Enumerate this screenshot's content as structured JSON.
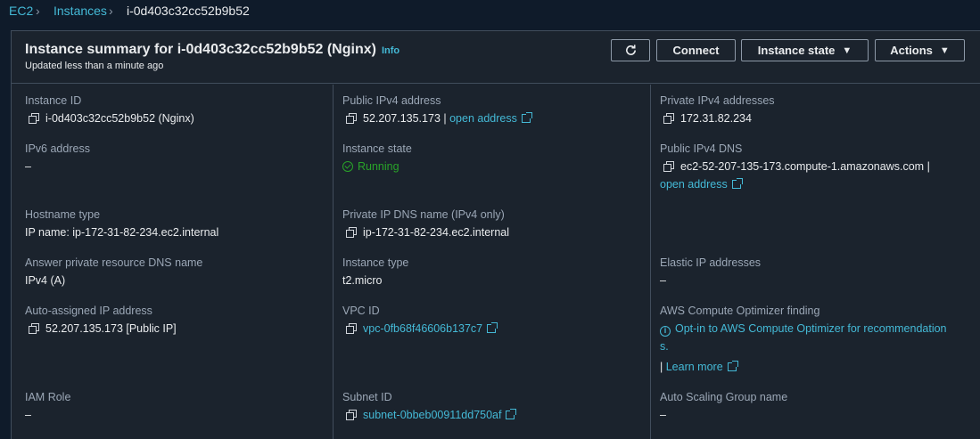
{
  "breadcrumb": {
    "ec2": "EC2",
    "instances": "Instances",
    "current": "i-0d403c32cc52b9b52"
  },
  "header": {
    "title": "Instance summary for i-0d403c32cc52b9b52 (Nginx)",
    "info": "Info",
    "updated": "Updated less than a minute ago",
    "connect": "Connect",
    "instance_state": "Instance state",
    "actions": "Actions"
  },
  "col1": {
    "instance_id_label": "Instance ID",
    "instance_id": "i-0d403c32cc52b9b52 (Nginx)",
    "ipv6_label": "IPv6 address",
    "ipv6": "–",
    "hostname_type_label": "Hostname type",
    "hostname_type": "IP name: ip-172-31-82-234.ec2.internal",
    "answer_dns_label": "Answer private resource DNS name",
    "answer_dns": "IPv4 (A)",
    "auto_ip_label": "Auto-assigned IP address",
    "auto_ip": "52.207.135.173 [Public IP]",
    "iam_label": "IAM Role",
    "iam": "–"
  },
  "col2": {
    "public_ipv4_label": "Public IPv4 address",
    "public_ipv4": "52.207.135.173",
    "sep": "|",
    "open_address": "open address",
    "state_label": "Instance state",
    "state": "Running",
    "private_dns_label": "Private IP DNS name (IPv4 only)",
    "private_dns": "ip-172-31-82-234.ec2.internal",
    "type_label": "Instance type",
    "type": "t2.micro",
    "vpc_label": "VPC ID",
    "vpc": "vpc-0fb68f46606b137c7",
    "subnet_label": "Subnet ID",
    "subnet": "subnet-0bbeb00911dd750af"
  },
  "col3": {
    "private_ipv4_label": "Private IPv4 addresses",
    "private_ipv4": "172.31.82.234",
    "public_dns_label": "Public IPv4 DNS",
    "public_dns": "ec2-52-207-135-173.compute-1.amazonaws.com",
    "sep": "|",
    "open_address": "open address",
    "elastic_label": "Elastic IP addresses",
    "elastic": "–",
    "optimizer_label": "AWS Compute Optimizer finding",
    "optimizer_line1": "Opt-in to AWS Compute Optimizer for recommendation",
    "optimizer_line2": "s.",
    "learn_sep": "|",
    "learn_more": "Learn more",
    "asg_label": "Auto Scaling Group name",
    "asg": "–"
  },
  "colors": {
    "accent": "#44b9d6",
    "running": "#29a329",
    "bg": "#1b232d"
  }
}
